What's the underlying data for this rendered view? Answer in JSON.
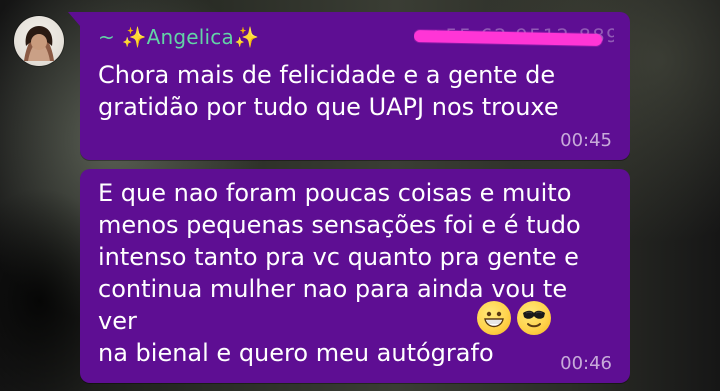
{
  "chat": {
    "messages": [
      {
        "sender": "~ ✨Angelica✨",
        "phone": "+55 62 9512-8899",
        "text": "Chora mais de felicidade e a gente de\ngratidão por tudo que UAPJ nos trouxe",
        "time": "00:45"
      },
      {
        "text": "E que nao foram poucas coisas e muito\nmenos pequenas sensações foi e é tudo\nintenso tanto pra vc quanto pra gente e\ncontinua mulher nao para ainda vou te ver\nna bienal e quero meu autógrafo",
        "emojis": [
          "grinning-face-emoji",
          "sunglasses-face-emoji"
        ],
        "time": "00:46"
      }
    ]
  },
  "colors": {
    "bubble": "#5e0e93",
    "sender_name": "#63d3a6",
    "redaction": "#ff35d6"
  }
}
